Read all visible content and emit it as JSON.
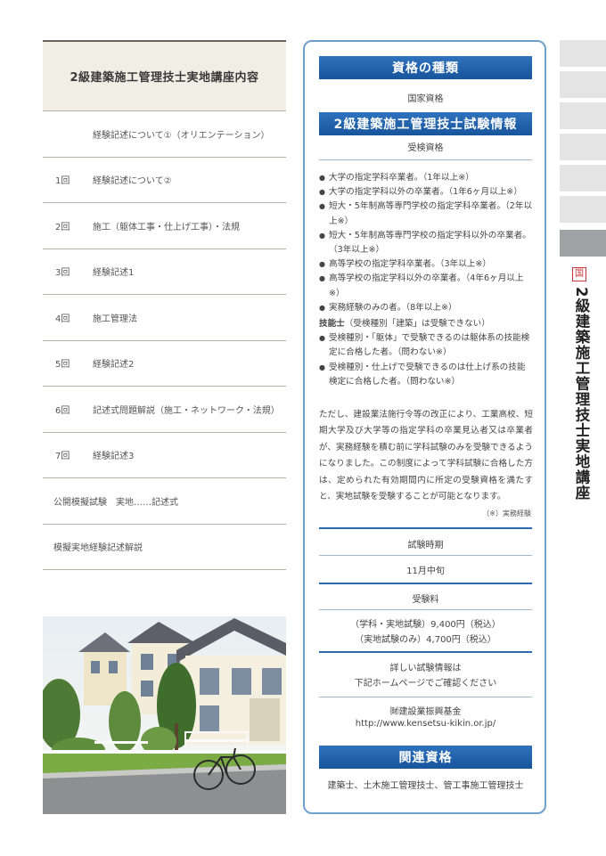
{
  "course": {
    "title": "2級建築施工管理技士実地講座内容",
    "rows": [
      {
        "num": "",
        "text": "経験記述について①（オリエンテーション）"
      },
      {
        "num": "1回",
        "text": "経験記述について②"
      },
      {
        "num": "2回",
        "text": "施工（躯体工事・仕上げ工事）・法規"
      },
      {
        "num": "3回",
        "text": "経験記述1"
      },
      {
        "num": "4回",
        "text": "施工管理法"
      },
      {
        "num": "5回",
        "text": "経験記述2"
      },
      {
        "num": "6回",
        "text": "記述式問題解説（施工・ネットワーク・法規）"
      },
      {
        "num": "7回",
        "text": "経験記述3"
      }
    ],
    "extra_rows": [
      "公開模擬試験　実地……記述式",
      "模擬実地経験記述解説"
    ]
  },
  "panel": {
    "type_header": "資格の種類",
    "type_value": "国家資格",
    "info_header": "2級建築施工管理技士試験情報",
    "eligibility_label": "受検資格",
    "eligibility_items": [
      "大学の指定学科卒業者。（1年以上※）",
      "大学の指定学科以外の卒業者。（1年6ヶ月以上※）",
      "短大・5年制高等専門学校の指定学科卒業者。（2年以上※）",
      "短大・5年制高等専門学校の指定学科以外の卒業者。（3年以上※）",
      "高等学校の指定学科卒業者。（3年以上※）",
      "高等学校の指定学科以外の卒業者。（4年6ヶ月以上※）",
      "実務経験のみの者。（8年以上※）"
    ],
    "skill_title": "技能士",
    "skill_note": "（受検種別「建築」は受験できない）",
    "skill_items": [
      "受検種別・「躯体」で受験できるのは躯体系の技能検定に合格した者。（問わない※）",
      "受検種別・仕上げで受験できるのは仕上げ系の技能検定に合格した者。（問わない※）"
    ],
    "note": "ただし、建設業法施行令等の改正により、工業高校、短期大学及び大学等の指定学科の卒業見込者又は卒業者が、実務経験を積む前に学科試験のみを受験できるようになりました。この制度によって学科試験に合格した方は、定められた有効期間内に所定の受験資格を満たすと、実地試験を受験することが可能となります。",
    "note_ref": "（※）実務経験",
    "exam_period_label": "試験時期",
    "exam_period_value": "11月中旬",
    "fee_label": "受験料",
    "fee_lines": [
      "（学科・実地試験）9,400円（税込）",
      "（実地試験のみ）4,700円（税込）"
    ],
    "detail_lines": [
      "詳しい試験情報は",
      "下記ホームページでご確認ください"
    ],
    "org_name": "㈶建設業振興基金",
    "org_url": "http://www.kensetsu-kikin.or.jp/",
    "related_header": "関連資格",
    "related_value": "建築士、土木施工管理技士、管工事施工管理技士"
  },
  "sidebar": {
    "badge": "国",
    "title": "2級建築施工管理技士実地講座"
  },
  "colors": {
    "accent_blue": "#1f63ad",
    "panel_border": "#6fa0cc",
    "course_header_bg": "#f1eee5",
    "badge_red": "#c8363a"
  }
}
